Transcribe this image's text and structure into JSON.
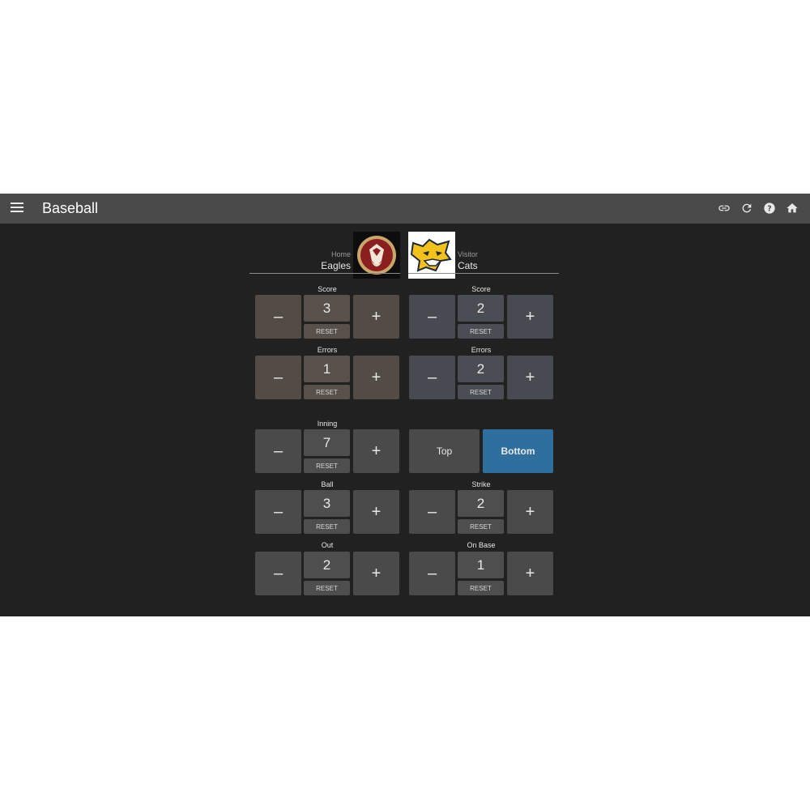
{
  "app": {
    "title": "Baseball"
  },
  "actions": [
    "link-icon",
    "refresh-icon",
    "help-icon",
    "home-icon"
  ],
  "teams": {
    "home": {
      "role": "Home",
      "name": "Eagles"
    },
    "visitor": {
      "role": "Visitor",
      "name": "Cats"
    }
  },
  "controls": {
    "minus": "–",
    "plus": "+",
    "reset": "RESET"
  },
  "home": {
    "score": {
      "label": "Score",
      "value": "3"
    },
    "errors": {
      "label": "Errors",
      "value": "1"
    }
  },
  "visitor": {
    "score": {
      "label": "Score",
      "value": "2"
    },
    "errors": {
      "label": "Errors",
      "value": "2"
    }
  },
  "game": {
    "inning": {
      "label": "Inning",
      "value": "7"
    },
    "half": {
      "top": "Top",
      "bottom": "Bottom",
      "selected": "Bottom"
    },
    "ball": {
      "label": "Ball",
      "value": "3"
    },
    "strike": {
      "label": "Strike",
      "value": "2"
    },
    "out": {
      "label": "Out",
      "value": "2"
    },
    "onbase": {
      "label": "On Base",
      "value": "1"
    }
  },
  "colors": {
    "appbar": "#4a4a4a",
    "background": "#212121",
    "home_tint": "#524b46",
    "visitor_tint": "#474a51",
    "accent": "#2f6f9e"
  }
}
